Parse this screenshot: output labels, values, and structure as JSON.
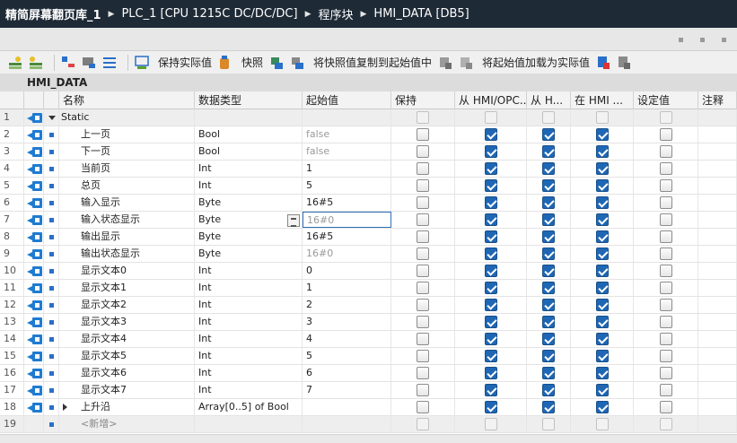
{
  "breadcrumb": [
    "精简屏幕翻页库_1",
    "PLC_1 [CPU 1215C DC/DC/DC]",
    "程序块",
    "HMI_DATA [DB5]"
  ],
  "toolbar": {
    "keep_actual": "保持实际值",
    "snapshot": "快照",
    "copy_snapshot": "将快照值复制到起始值中",
    "load_start": "将起始值加载为实际值"
  },
  "db_name": "HMI_DATA",
  "columns": {
    "name": "名称",
    "type": "数据类型",
    "start": "起始值",
    "retain": "保持",
    "hmi_opc": "从 HMI/OPC...",
    "hmi_h": "从 H...",
    "in_hmi": "在 HMI ...",
    "setpoint": "设定值",
    "comment": "注释"
  },
  "rows": [
    {
      "num": "1",
      "name": "Static",
      "type": "",
      "start": "",
      "kind": "static"
    },
    {
      "num": "2",
      "name": "上一页",
      "type": "Bool",
      "start": "false",
      "start_grey": true
    },
    {
      "num": "3",
      "name": "下一页",
      "type": "Bool",
      "start": "false",
      "start_grey": true
    },
    {
      "num": "4",
      "name": "当前页",
      "type": "Int",
      "start": "1"
    },
    {
      "num": "5",
      "name": "总页",
      "type": "Int",
      "start": "5"
    },
    {
      "num": "6",
      "name": "输入显示",
      "type": "Byte",
      "start": "16#5"
    },
    {
      "num": "7",
      "name": "输入状态显示",
      "type": "Byte",
      "start": "16#0",
      "start_grey": true,
      "editing": true
    },
    {
      "num": "8",
      "name": "输出显示",
      "type": "Byte",
      "start": "16#5"
    },
    {
      "num": "9",
      "name": "输出状态显示",
      "type": "Byte",
      "start": "16#0",
      "start_grey": true
    },
    {
      "num": "10",
      "name": "显示文本0",
      "type": "Int",
      "start": "0"
    },
    {
      "num": "11",
      "name": "显示文本1",
      "type": "Int",
      "start": "1"
    },
    {
      "num": "12",
      "name": "显示文本2",
      "type": "Int",
      "start": "2"
    },
    {
      "num": "13",
      "name": "显示文本3",
      "type": "Int",
      "start": "3"
    },
    {
      "num": "14",
      "name": "显示文本4",
      "type": "Int",
      "start": "4"
    },
    {
      "num": "15",
      "name": "显示文本5",
      "type": "Int",
      "start": "5"
    },
    {
      "num": "16",
      "name": "显示文本6",
      "type": "Int",
      "start": "6"
    },
    {
      "num": "17",
      "name": "显示文本7",
      "type": "Int",
      "start": "7"
    },
    {
      "num": "18",
      "name": "上升沿",
      "type": "Array[0..5] of Bool",
      "start": "",
      "kind": "array"
    },
    {
      "num": "19",
      "name": "<新增>",
      "type": "",
      "start": "",
      "kind": "new"
    }
  ],
  "colors": {
    "title_bg": "#1e2a36",
    "check_blue": "#1f67b4",
    "db_icon_blue": "#1f7bd1"
  }
}
